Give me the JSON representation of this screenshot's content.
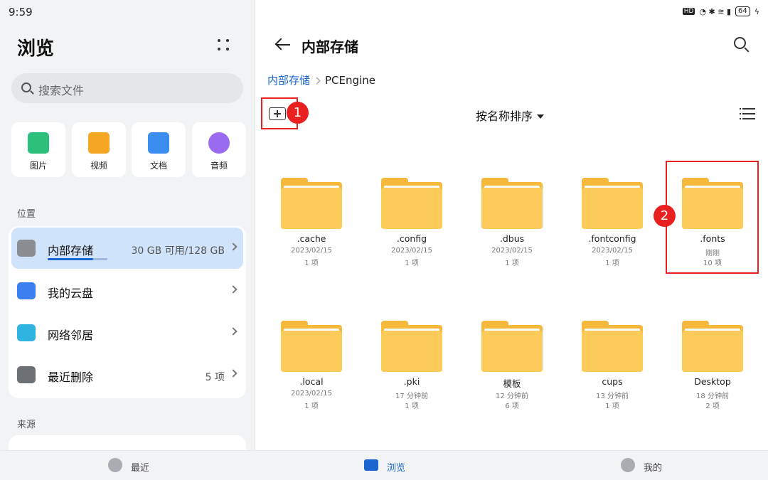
{
  "status_bar": {
    "time": "9:59",
    "hd": "HD",
    "battery": "64"
  },
  "left": {
    "title": "浏览",
    "search_placeholder": "搜索文件",
    "categories": [
      {
        "label": "图片",
        "icon": "image-icon",
        "color": "#2dbf7c"
      },
      {
        "label": "视频",
        "icon": "video-icon",
        "color": "#f5a623"
      },
      {
        "label": "文档",
        "icon": "document-icon",
        "color": "#3b8ef0"
      },
      {
        "label": "音频",
        "icon": "audio-icon",
        "color": "#9a6af0"
      }
    ],
    "locations_label": "位置",
    "locations": [
      {
        "label": "内部存储",
        "right": "30 GB 可用/128 GB",
        "icon": "phone-storage-icon"
      },
      {
        "label": "我的云盘",
        "right": "",
        "icon": "cloud-drive-icon"
      },
      {
        "label": "网络邻居",
        "right": "",
        "icon": "network-icon"
      },
      {
        "label": "最近删除",
        "right": "5 项",
        "icon": "trash-icon"
      }
    ],
    "sources_label": "来源"
  },
  "right": {
    "title": "内部存储",
    "breadcrumb": [
      "内部存储",
      "PCEngine"
    ],
    "sort_label": "按名称排序",
    "badge1": "1",
    "badge2": "2",
    "folders": [
      {
        "name": ".cache",
        "date": "2023/02/15",
        "count": "1 项"
      },
      {
        "name": ".config",
        "date": "2023/02/15",
        "count": "1 项"
      },
      {
        "name": ".dbus",
        "date": "2023/02/15",
        "count": "1 项"
      },
      {
        "name": ".fontconfig",
        "date": "2023/02/15",
        "count": "1 项"
      },
      {
        "name": ".fonts",
        "date": "刚刚",
        "count": "10 项"
      },
      {
        "name": ".local",
        "date": "2023/02/15",
        "count": "1 项"
      },
      {
        "name": ".pki",
        "date": "17 分钟前",
        "count": "1 项"
      },
      {
        "name": "模板",
        "date": "12 分钟前",
        "count": "6 项"
      },
      {
        "name": "cups",
        "date": "13 分钟前",
        "count": "1 项"
      },
      {
        "name": "Desktop",
        "date": "18 分钟前",
        "count": "2 项"
      }
    ]
  },
  "bottom_nav": [
    {
      "label": "最近",
      "icon": "clock-icon"
    },
    {
      "label": "浏览",
      "icon": "folder-icon"
    },
    {
      "label": "我的",
      "icon": "user-icon"
    }
  ],
  "colors": {
    "accent": "#1a66d0",
    "highlight": "#e8201f",
    "folder": "#fdcb5a"
  }
}
